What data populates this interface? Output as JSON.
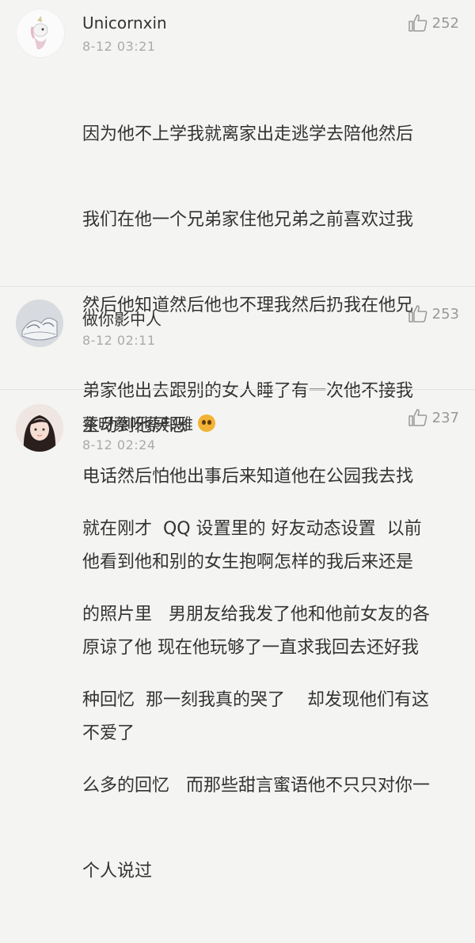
{
  "comments": [
    {
      "user": "Unicornxin",
      "time": "8-12 03:21",
      "likes": "252",
      "lines": [
        "因为他不上学我就离家出走逃学去陪他然后",
        "我们在他一个兄弟家住他兄弟之前喜欢过我",
        "然后他知道然后他也不理我然后扔我在他兄",
        "弟家他出去跟别的女人睡了有一次他不接我",
        "电话然后怕他出事后来知道他在公园我去找",
        "他看到他和别的女生抱啊怎样的我后来还是",
        "原谅了他 现在他玩够了一直求我回去还好我",
        "不爱了"
      ],
      "avatar_icon": "unicorn-avatar-icon"
    },
    {
      "user": "做你影中人",
      "time": "8-12 02:11",
      "likes": "253",
      "lines": [
        "主动到他厌恶"
      ],
      "avatar_icon": "sketch-avatar-icon"
    },
    {
      "user": "蔡呀蔡呀蔡邦雅",
      "time": "8-12 02:24",
      "likes": "237",
      "lines": [
        "就在刚才  QQ 设置里的 好友动态设置  以前",
        "的照片里   男朋友给我发了他和他前女友的各",
        "种回忆  那一刻我真的哭了    却发现他们有这",
        "么多的回忆   而那些甜言蜜语他不只只对你一",
        "个人说过"
      ],
      "avatar_icon": "girl-avatar-icon",
      "name_emoji": "crying-emoji-icon"
    }
  ],
  "colors": {
    "background": "#f4f4f2",
    "meta": "#aaaaaa",
    "text": "#333333"
  }
}
